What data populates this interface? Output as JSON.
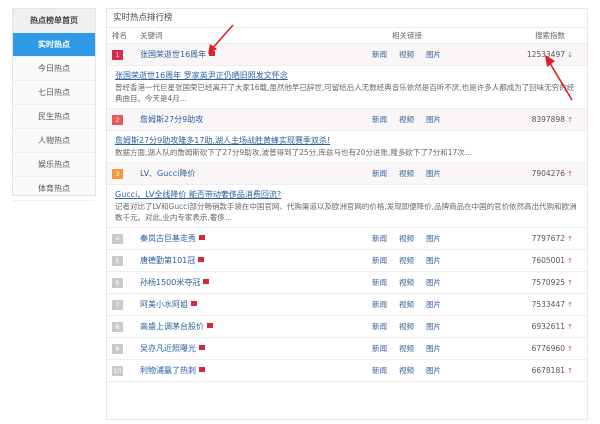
{
  "sidebar": {
    "header": "热点榜单首页",
    "items": [
      {
        "label": "实时热点",
        "active": true
      },
      {
        "label": "今日热点",
        "active": false
      },
      {
        "label": "七日热点",
        "active": false
      },
      {
        "label": "民生热点",
        "active": false
      },
      {
        "label": "人物热点",
        "active": false
      },
      {
        "label": "娱乐热点",
        "active": false
      },
      {
        "label": "体育热点",
        "active": false
      }
    ]
  },
  "main": {
    "title": "实时热点排行榜",
    "columns": {
      "rank": "排名",
      "keyword": "关键词",
      "links": "相关链接",
      "score": "搜索指数"
    },
    "link_labels": [
      "新闻",
      "视频",
      "图片"
    ],
    "rows": [
      {
        "rank": "1",
        "keyword": "张国荣逝世16周年",
        "score": "12533497",
        "trend": "down",
        "desc_title": "张国荣逝世16周年 罗家英尹正仍晒旧照发文怀念",
        "desc_text": "曾经香港一代巨星张国荣已经离开了大家16载,虽然他早已辞世,可留给后人无数经典音乐依然是百听不厌,也是许多人都成为了回味无穷的经典曲目。今天是4月..."
      },
      {
        "rank": "2",
        "keyword": "詹姆斯27分9助攻",
        "score": "8397898",
        "trend": "up",
        "desc_title": "詹姆斯27分9助攻隆多17助,湖人主场战胜黄蜂实现赛季双杀!",
        "desc_text": "数据方面,湖人队的詹姆斯砍下了27分9助攻,波普得到了25分,库兹马也有20分进账,隆多砍下了7分和17次..."
      },
      {
        "rank": "3",
        "keyword": "LV、Gucci降价",
        "score": "7904276",
        "trend": "up",
        "desc_title": "Gucci、LV全线降价 能否带动奢侈品消费回流?",
        "desc_text": "记者对比了LV和Gucci部分畅销款手袋在中国官网、代购渠道以及欧洲官网的价格,发现即便降价,品牌商品在中国的官价依然高出代购和欧洲数千元。对此,业内专家表示,奢侈..."
      },
      {
        "rank": "4",
        "keyword": "秦岚古巨基走秀",
        "score": "7797672",
        "trend": "up"
      },
      {
        "rank": "5",
        "keyword": "唐德勤第101冠",
        "score": "7605001",
        "trend": "up"
      },
      {
        "rank": "6",
        "keyword": "孙杨1500米夺冠",
        "score": "7570925",
        "trend": "up"
      },
      {
        "rank": "7",
        "keyword": "阿美小水阿姐",
        "score": "7533447",
        "trend": "up"
      },
      {
        "rank": "8",
        "keyword": "高盛上调茅台股价",
        "score": "6932611",
        "trend": "up"
      },
      {
        "rank": "9",
        "keyword": "吴亦凡近照曝光",
        "score": "6776960",
        "trend": "up"
      },
      {
        "rank": "10",
        "keyword": "利物浦赢了热刺",
        "score": "6678181",
        "trend": "up"
      }
    ]
  },
  "icons": {
    "trend_down": "↓",
    "trend_up": "↑"
  },
  "colors": {
    "active_tab": "#2f9ae8",
    "rank1": "#d42b4f",
    "link": "#2c5f9e",
    "annotation_arrow": "#e02020"
  }
}
